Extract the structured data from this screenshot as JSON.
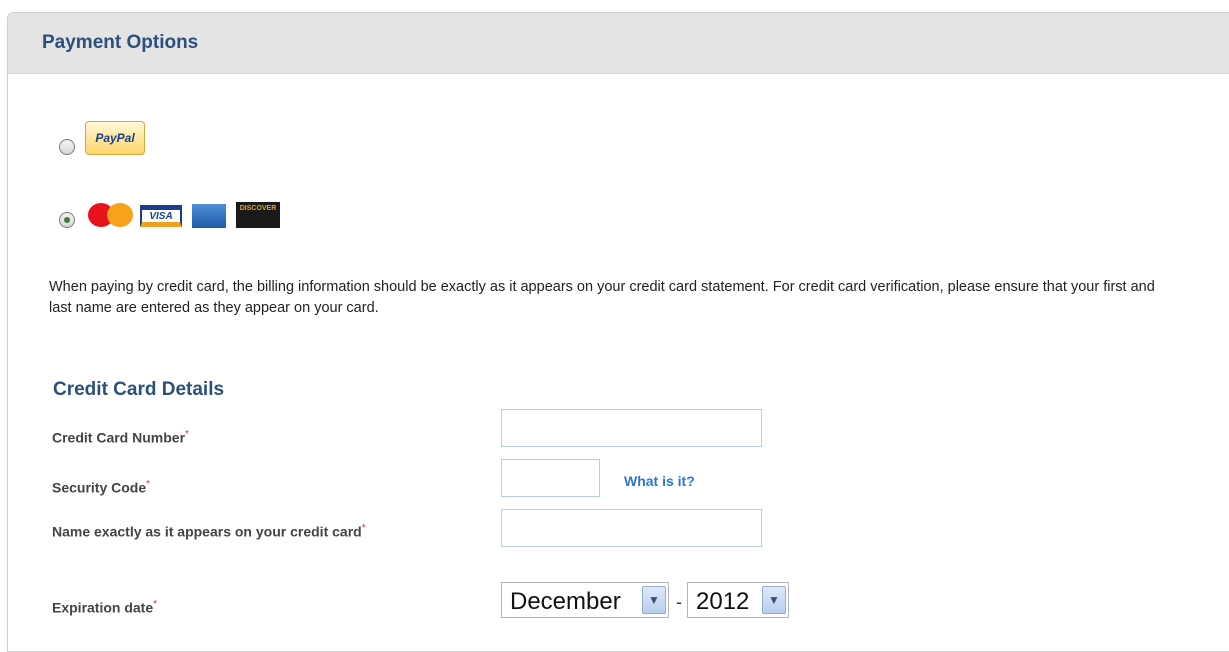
{
  "header": {
    "title": "Payment Options"
  },
  "payment_methods": [
    {
      "id": "paypal",
      "logo_text": "PayPal",
      "logo_icon": "paypal-logo-icon",
      "selected": false
    },
    {
      "id": "credit-card",
      "selected": true,
      "card_logos": [
        {
          "name": "mastercard-logo-icon",
          "text": "MasterCard"
        },
        {
          "name": "visa-logo-icon",
          "text": "VISA"
        },
        {
          "name": "amex-logo-icon",
          "text": "AMERICAN EXPRESS"
        },
        {
          "name": "discover-logo-icon",
          "text": "DISCOVER"
        }
      ]
    }
  ],
  "info_text": "When paying by credit card, the billing information should be exactly as it appears on your credit card statement. For credit card verification, please ensure that your first and last name are entered as they appear on your card.",
  "credit_card_details": {
    "title": "Credit Card Details",
    "required_marker": "*",
    "card_number": {
      "label": "Credit Card Number",
      "value": ""
    },
    "security_code": {
      "label": "Security Code",
      "value": "",
      "help_link": "What is it?"
    },
    "name_on_card": {
      "label": "Name exactly as it appears on your credit card",
      "value": ""
    },
    "expiration": {
      "label": "Expiration date",
      "month": "December",
      "separator": "-",
      "year": "2012"
    }
  },
  "colors": {
    "header_bg": "#e4e4e4",
    "title_color": "#2c4f7c",
    "link_color": "#2f74d0",
    "required_color": "#e03030"
  }
}
